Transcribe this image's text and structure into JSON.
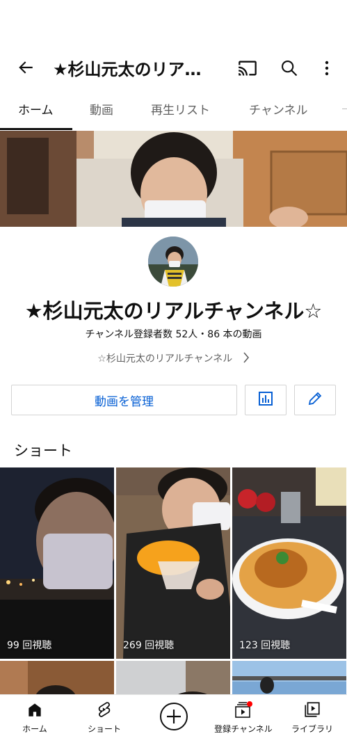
{
  "header": {
    "title": "★杉山元太のリア…"
  },
  "tabs": [
    {
      "label": "ホーム"
    },
    {
      "label": "動画"
    },
    {
      "label": "再生リスト"
    },
    {
      "label": "チャンネル"
    }
  ],
  "channel": {
    "name": "★杉山元太のリアルチャンネル☆",
    "stats": "チャンネル登録者数 52人・86 本の動画",
    "link_text": "☆杉山元太のリアルチャンネル"
  },
  "actions": {
    "manage_label": "動画を管理"
  },
  "shorts": {
    "heading": "ショート",
    "items": [
      {
        "views": "99 回視聴"
      },
      {
        "views": "269 回視聴"
      },
      {
        "views": "123 回視聴"
      }
    ]
  },
  "bottom_nav": [
    {
      "label": "ホーム",
      "icon": "home-icon"
    },
    {
      "label": "ショート",
      "icon": "shorts-icon"
    },
    {
      "label": "",
      "icon": "create-icon"
    },
    {
      "label": "登録チャンネル",
      "icon": "subscriptions-icon"
    },
    {
      "label": "ライブラリ",
      "icon": "library-icon"
    }
  ],
  "colors": {
    "accent_blue": "#065fd4",
    "notification_red": "#ff0000"
  }
}
